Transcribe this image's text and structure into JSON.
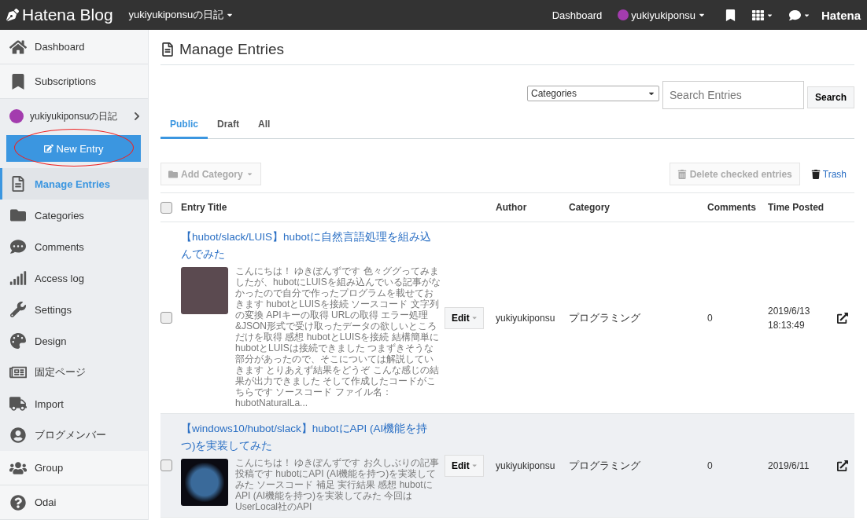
{
  "topbar": {
    "logo": "Hatena Blog",
    "blog_title": "yukiyukiponsuの日記",
    "dashboard": "Dashboard",
    "user": "yukiyukiponsu",
    "brand": "Hatena"
  },
  "sidebar": {
    "top_items": [
      {
        "label": "Dashboard",
        "selected": false
      },
      {
        "label": "Subscriptions",
        "selected": false
      }
    ],
    "blog": {
      "name": "yukiyukiponsuの日記",
      "new_entry": "New Entry",
      "items": [
        {
          "label": "Manage Entries",
          "selected": true
        },
        {
          "label": "Categories",
          "selected": false
        },
        {
          "label": "Comments",
          "selected": false
        },
        {
          "label": "Access log",
          "selected": false
        },
        {
          "label": "Settings",
          "selected": false
        },
        {
          "label": "Design",
          "selected": false
        },
        {
          "label": "固定ページ",
          "selected": false
        },
        {
          "label": "Import",
          "selected": false
        },
        {
          "label": "ブログメンバー",
          "selected": false
        }
      ]
    },
    "bottom_items": [
      {
        "label": "Group",
        "selected": false
      },
      {
        "label": "Odai",
        "selected": false
      }
    ]
  },
  "page": {
    "title": "Manage Entries",
    "category_select": "Categories",
    "search": {
      "placeholder": "Search Entries"
    },
    "search_button": "Search",
    "tabs": [
      {
        "label": "Public",
        "selected": true
      },
      {
        "label": "Draft",
        "selected": false
      },
      {
        "label": "All",
        "selected": false
      }
    ],
    "add_category": "Add Category",
    "delete_button": "Delete checked entries",
    "trash": "Trash",
    "columns": [
      "Entry Title",
      "Author",
      "Category",
      "Comments",
      "Time Posted"
    ],
    "select_all": {
      "checked": false
    },
    "rows": [
      {
        "title": "【hubot/slack/LUIS】hubotに自然言語処理を組み込んでみた",
        "excerpt": "こんにちは！ ゆきぽんずです 色々ググってみましたが、hubotにLUISを組み込んでいる記事がなかったので自分で作ったプログラムを載せておきます hubotとLUISを接続 ソースコード 文字列の変換 APIキーの取得 URLの取得 エラー処理&JSON形式で受け取ったデータの欲しいところだけを取得 感想 hubotとLUISを接続 結構簡単にhubotとLUISは接続できました つまずきそうな部分があったので、そこについては解説していきます とりあえず結果をどうぞ こんな感じの結果が出力できました そして作成したコードがこちらです ソースコード ファイル名：hubotNaturalLa...",
        "edit": "Edit",
        "author": "yukiyukiponsu",
        "category": "プログラミング",
        "comments": "0",
        "date": "2019/6/13",
        "time": "18:13:49",
        "checked": false,
        "hovered": false
      },
      {
        "title": "【windows10/hubot/slack】hubotにAPI (AI機能を持つ)を実装してみた",
        "excerpt": "こんにちは！ ゆきぽんずです お久しぶりの記事投稿です hubotにAPI (AI機能を持つ)を実装してみた ソースコード 補足 実行結果 感想 hubotにAPI (AI機能を持つ)を実装してみた 今回はUserLocal社のAPI",
        "edit": "Edit",
        "author": "yukiyukiponsu",
        "category": "プログラミング",
        "comments": "0",
        "date": "2019/6/11",
        "checked": false,
        "hovered": true
      }
    ]
  }
}
